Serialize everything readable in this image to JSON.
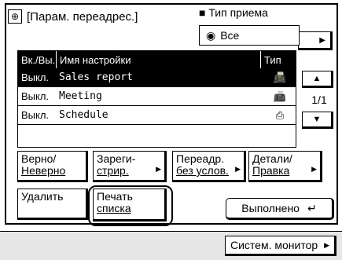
{
  "header": {
    "settings_icon": "settings-icon",
    "title": "[Парам. переадрес.]",
    "recv_type_label": "Тип приема",
    "recv_type_value": "Все"
  },
  "table": {
    "columns": [
      "Вк./Вы.",
      "Имя настройки",
      "Тип"
    ],
    "rows": [
      {
        "state": "Выкл.",
        "name": "Sales report",
        "type_icon": "fax-icon",
        "selected": true
      },
      {
        "state": "Выкл.",
        "name": "Meeting",
        "type_icon": "fax-icon",
        "selected": false
      },
      {
        "state": "Выкл.",
        "name": "Schedule",
        "type_icon": "printer-icon",
        "selected": false
      }
    ]
  },
  "pager": {
    "page": "1/1"
  },
  "buttons": {
    "valid_line1": "Верно/",
    "valid_line2": "Неверно",
    "register_line1": "Зареги-",
    "register_line2": "стрир.",
    "forward_line1": "Переадр.",
    "forward_line2": "без услов.",
    "details_line1": "Детали/",
    "details_line2": "Правка",
    "delete": "Удалить",
    "print_line1": "Печать",
    "print_line2": "списка",
    "execute": "Выполнено",
    "system_monitor": "Систем. монитор"
  }
}
